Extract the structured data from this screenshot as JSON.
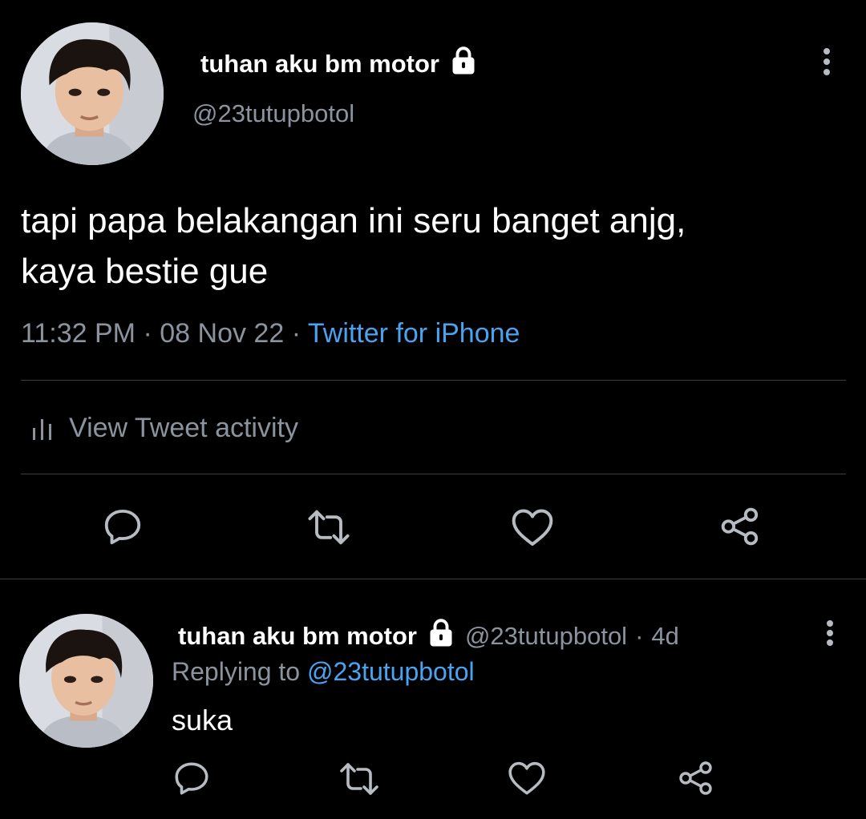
{
  "tweet": {
    "author": {
      "display_name": "tuhan aku bm motor",
      "handle": "@23tutupbotol",
      "protected": true
    },
    "text_line1": "tapi papa belakangan ini seru banget anjg,",
    "text_line2": "kaya bestie gue",
    "time": "11:32 PM",
    "date": "08 Nov 22",
    "separator": "·",
    "source": "Twitter for iPhone",
    "activity_label": "View Tweet activity",
    "icons": {
      "more": "more-vertical-icon",
      "lock": "lock-icon",
      "activity": "bar-chart-icon",
      "reply": "reply-icon",
      "retweet": "retweet-icon",
      "like": "heart-icon",
      "share": "share-icon"
    }
  },
  "reply": {
    "author": {
      "display_name": "tuhan aku bm motor",
      "handle": "@23tutupbotol",
      "protected": true
    },
    "age": "4d",
    "separator": "·",
    "replying_prefix": "Replying to",
    "replying_to": "@23tutupbotol",
    "text": "suka"
  },
  "colors": {
    "background": "#000000",
    "text": "#ffffff",
    "secondary_text": "#8b949e",
    "link": "#4aa3f0",
    "divider": "#3a3f45",
    "icon": "#b7bcc2"
  }
}
